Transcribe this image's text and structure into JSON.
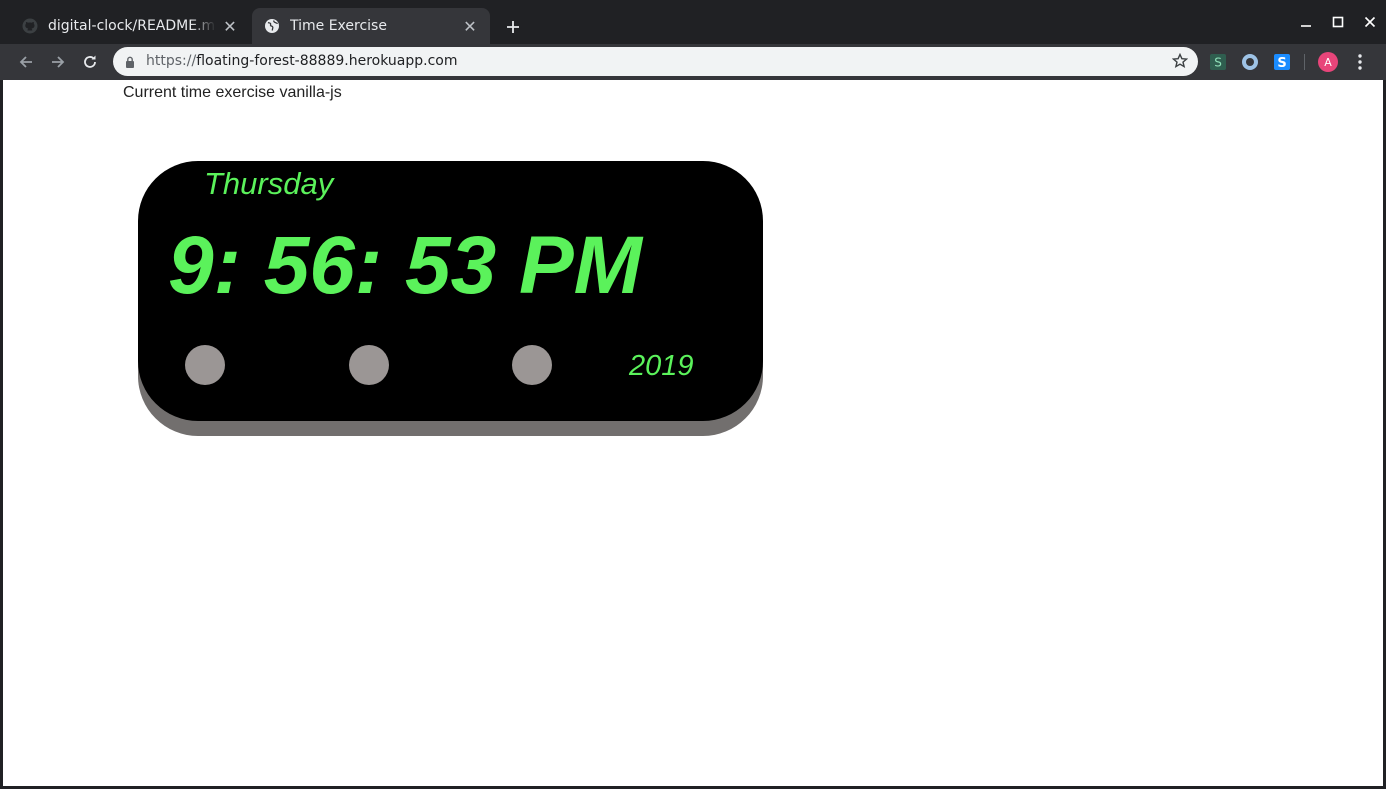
{
  "browser": {
    "tabs": [
      {
        "title": "digital-clock/README.md",
        "favicon": "github-icon",
        "active": false
      },
      {
        "title": "Time Exercise",
        "favicon": "globe-icon",
        "active": true
      }
    ],
    "new_tab_symbol": "+",
    "close_symbol": "✕",
    "url": {
      "scheme": "https://",
      "host": "floating-forest-88889.herokuapp.com"
    },
    "profile_initial": "A",
    "extensions": [
      "sheets-s-icon",
      "circle-extension-icon",
      "s-extension-icon"
    ]
  },
  "page": {
    "heading": "Current time exercise vanilla-js",
    "clock": {
      "day": "Thursday",
      "time": "9: 56: 53 PM",
      "year": "2019",
      "text_color": "#5bf25b",
      "body_color": "#000000",
      "dot_color": "#9b9695"
    }
  }
}
